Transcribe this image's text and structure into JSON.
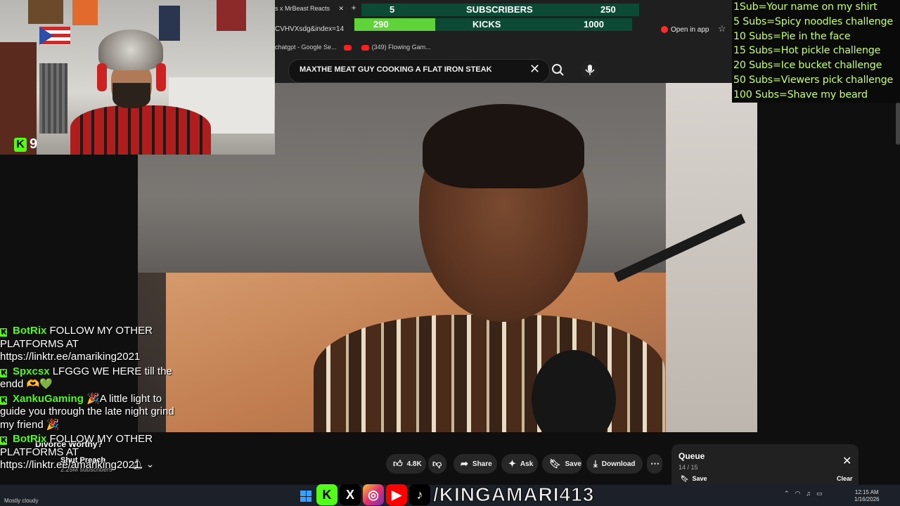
{
  "stream": {
    "kick_viewer_count": "9",
    "handle": "/KINGAMARI413"
  },
  "goal_overlay": {
    "row1_left": "5",
    "row1_label": "SUBSCRIBERS",
    "row1_right": "250",
    "row2_left": "290",
    "row2_label": "KICKS",
    "row2_right": "1000",
    "kicks_progress": 0.29
  },
  "browser": {
    "tab_fragment": "s x MrBeast Reacts",
    "address_fragment": "CVHVXsdg&index=14",
    "open_in_app": "Open in app",
    "bookmarks": [
      "chatgpt - Google Se...",
      "(349) Flowing Gam..."
    ]
  },
  "youtube": {
    "search_query": "MAXTHE MEAT GUY COOKING A FLAT IRON STEAK",
    "video_title": "Divorce Worthy?",
    "channel_name": "Shut Preach",
    "channel_subs": "2.25M subscribers",
    "actions": {
      "likes": "4.8K",
      "share": "Share",
      "ask": "Ask",
      "save": "Save",
      "download": "Download"
    },
    "queue": {
      "title": "Queue",
      "count": "14 / 15",
      "save": "Save",
      "clear": "Clear"
    }
  },
  "challenges": [
    "1Sub=Your name on my shirt",
    "5 Subs=Spicy noodles challenge",
    "10 Subs=Pie in the face",
    "15 Subs=Hot pickle challenge",
    "20 Subs=Ice bucket challenge",
    "50 Subs=Viewers pick challenge",
    "100 Subs=Shave my beard"
  ],
  "chat": [
    {
      "user": "BotRix",
      "message": "FOLLOW MY OTHER PLATFORMS AT https://linktr.ee/amariking2021"
    },
    {
      "user": "Spxcsx",
      "message": "LFGGG WE HERE till the endd 🫶💚"
    },
    {
      "user": "XankuGaming",
      "message": "🎉A little light to guide you through the late night grind my friend 🎉"
    },
    {
      "user": "BotRix",
      "message": "FOLLOW MY OTHER PLATFORMS AT https://linktr.ee/amariking2021"
    }
  ],
  "taskbar": {
    "weather": "Mostly cloudy",
    "time": "12:15 AM",
    "date": "1/16/2026"
  },
  "colors": {
    "kick_green": "#53fc18",
    "goal_green": "#5fd33a",
    "goal_dark": "#0c4a36",
    "challenge_text": "#c7ff6a",
    "youtube_red": "#ff1f1f"
  }
}
